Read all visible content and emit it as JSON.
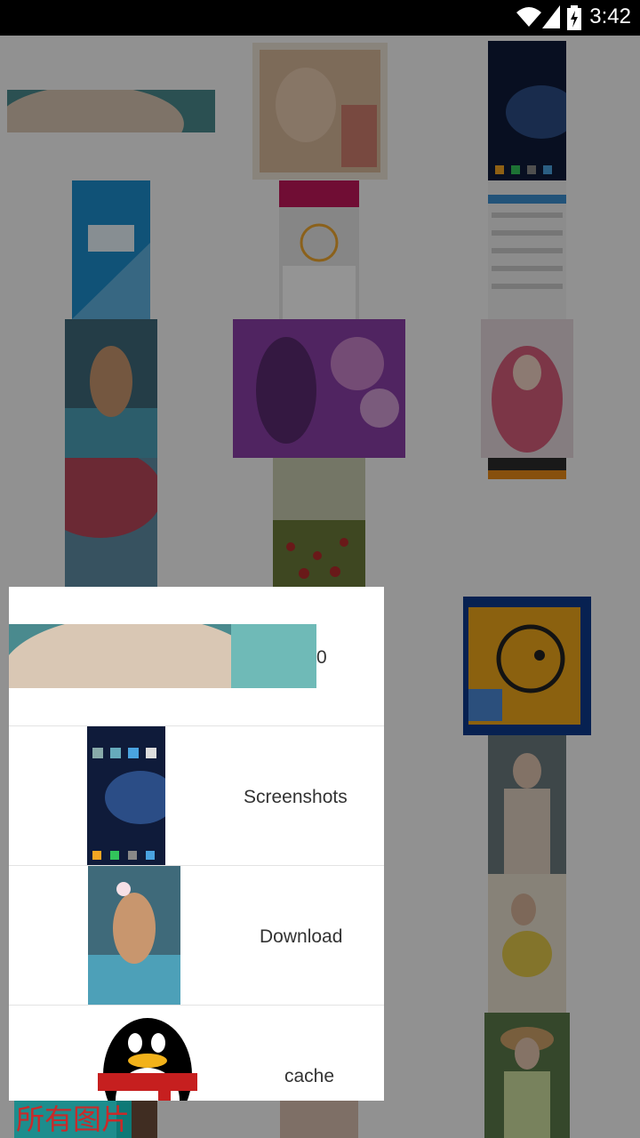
{
  "status_bar": {
    "time": "3:42"
  },
  "grid": {
    "thumbnails": [
      {
        "name": "thumb-face-banner",
        "colors": [
          "#4a8a8e",
          "#d9c7b4"
        ]
      },
      {
        "name": "thumb-girl-selfie",
        "colors": [
          "#d8b89a",
          "#6aa3a0"
        ]
      },
      {
        "name": "thumb-home-screenshot",
        "colors": [
          "#0f1b3a",
          "#2b4d86"
        ]
      },
      {
        "name": "thumb-app-splash",
        "colors": [
          "#1c8ecd",
          "#5fb2e0"
        ]
      },
      {
        "name": "thumb-app-dashboard",
        "colors": [
          "#e7e7e7",
          "#c2185b"
        ]
      },
      {
        "name": "thumb-app-list",
        "colors": [
          "#f2f2f2",
          "#3b8fd1"
        ]
      },
      {
        "name": "thumb-woman-pool",
        "colors": [
          "#3f6a7a",
          "#c8966e"
        ]
      },
      {
        "name": "thumb-anime-girl",
        "colors": [
          "#8a3fa8",
          "#e4a2d8"
        ]
      },
      {
        "name": "thumb-pink-hoodie",
        "colors": [
          "#e6d7dc",
          "#d65e7b"
        ]
      },
      {
        "name": "thumb-tree-blossom",
        "colors": [
          "#b8485b",
          "#5f8ea6"
        ]
      },
      {
        "name": "thumb-flower-field",
        "colors": [
          "#c8cbb0",
          "#b52b2b"
        ]
      },
      {
        "name": "thumb-orange-app",
        "colors": [
          "#e88b17",
          "#2c2c2c"
        ]
      },
      {
        "name": "thumb-cartoon-icon",
        "colors": [
          "#f0a81b",
          "#0d3a8c"
        ]
      },
      {
        "name": "thumb-woman-dress",
        "colors": [
          "#6c7a7e",
          "#e0d0c2"
        ]
      },
      {
        "name": "thumb-woman-sitting",
        "colors": [
          "#e9e0cf",
          "#e2c94b"
        ]
      },
      {
        "name": "thumb-woman-hat",
        "colors": [
          "#5c7a4b",
          "#cfe0a0"
        ]
      },
      {
        "name": "thumb-bottom-left",
        "colors": [
          "#6f4f3b",
          "#a58066"
        ]
      },
      {
        "name": "thumb-bottom-mid",
        "colors": [
          "#d9c0b0",
          "#a8866d"
        ]
      }
    ]
  },
  "folders": [
    {
      "name": "0",
      "thumb_colors": [
        "#4a8a8e",
        "#d9c7b4"
      ]
    },
    {
      "name": "Screenshots",
      "thumb_colors": [
        "#0f1b3a",
        "#2b4d86"
      ]
    },
    {
      "name": "Download",
      "thumb_colors": [
        "#3f6a7a",
        "#c8966e"
      ]
    },
    {
      "name": "cache",
      "thumb_colors": [
        "#000000",
        "#c61f1f"
      ]
    }
  ],
  "bottom_bar": {
    "label": "所有图片"
  }
}
